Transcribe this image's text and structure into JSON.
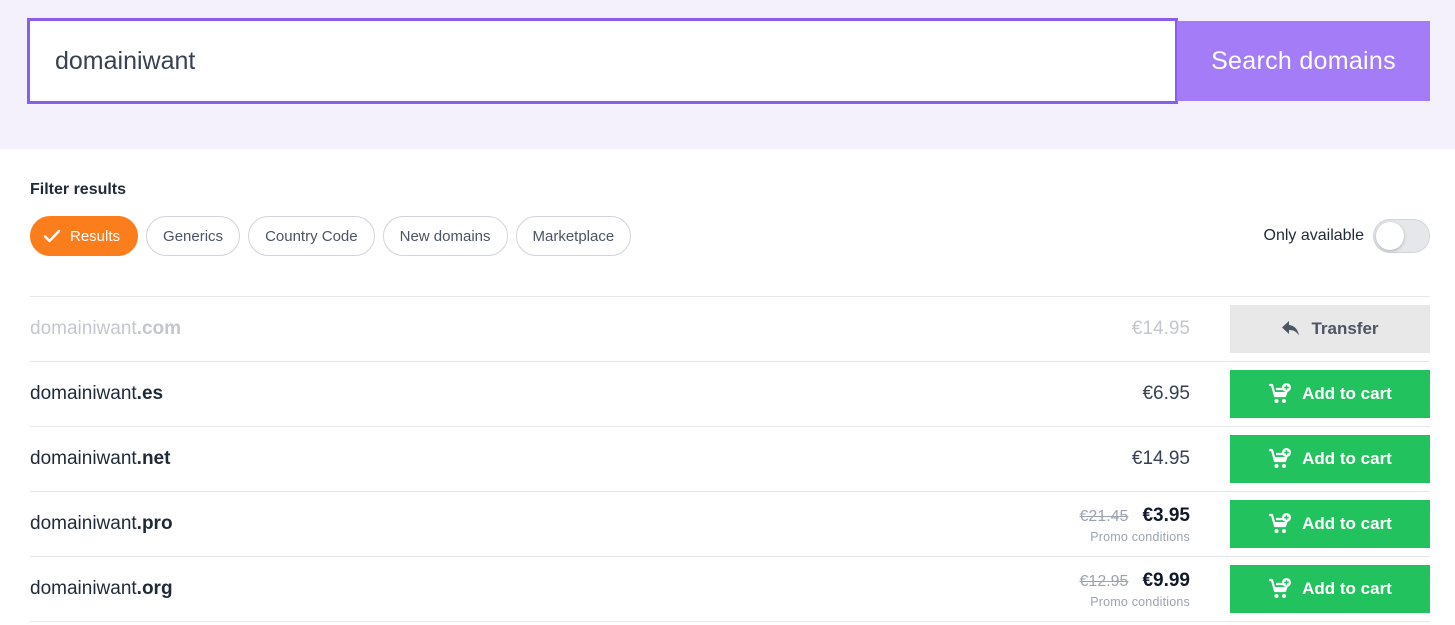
{
  "search": {
    "value": "domainiwant",
    "button_label": "Search domains"
  },
  "filters": {
    "title": "Filter results",
    "chips": [
      {
        "label": "Results",
        "active": true
      },
      {
        "label": "Generics",
        "active": false
      },
      {
        "label": "Country Code",
        "active": false
      },
      {
        "label": "New domains",
        "active": false
      },
      {
        "label": "Marketplace",
        "active": false
      }
    ],
    "only_available": {
      "label": "Only available",
      "on": false
    }
  },
  "results": [
    {
      "name": "domainiwant",
      "tld": ".com",
      "price": "€14.95",
      "action": "Transfer",
      "icon": "reply-arrow-icon"
    },
    {
      "name": "domainiwant",
      "tld": ".es",
      "price": "€6.95",
      "action": "Add to cart",
      "icon": "cart-plus-icon"
    },
    {
      "name": "domainiwant",
      "tld": ".net",
      "price": "€14.95",
      "action": "Add to cart",
      "icon": "cart-plus-icon"
    },
    {
      "name": "domainiwant",
      "tld": ".pro",
      "old_price": "€21.45",
      "new_price": "€3.95",
      "promo": "Promo conditions",
      "action": "Add to cart",
      "icon": "cart-plus-icon"
    },
    {
      "name": "domainiwant",
      "tld": ".org",
      "old_price": "€12.95",
      "new_price": "€9.99",
      "promo": "Promo conditions",
      "action": "Add to cart",
      "icon": "cart-plus-icon"
    }
  ],
  "colors": {
    "accent_purple": "#8a5cf0",
    "search_button": "#a47cf7",
    "active_chip": "#fb7d1b",
    "cart_green": "#22c35e"
  }
}
